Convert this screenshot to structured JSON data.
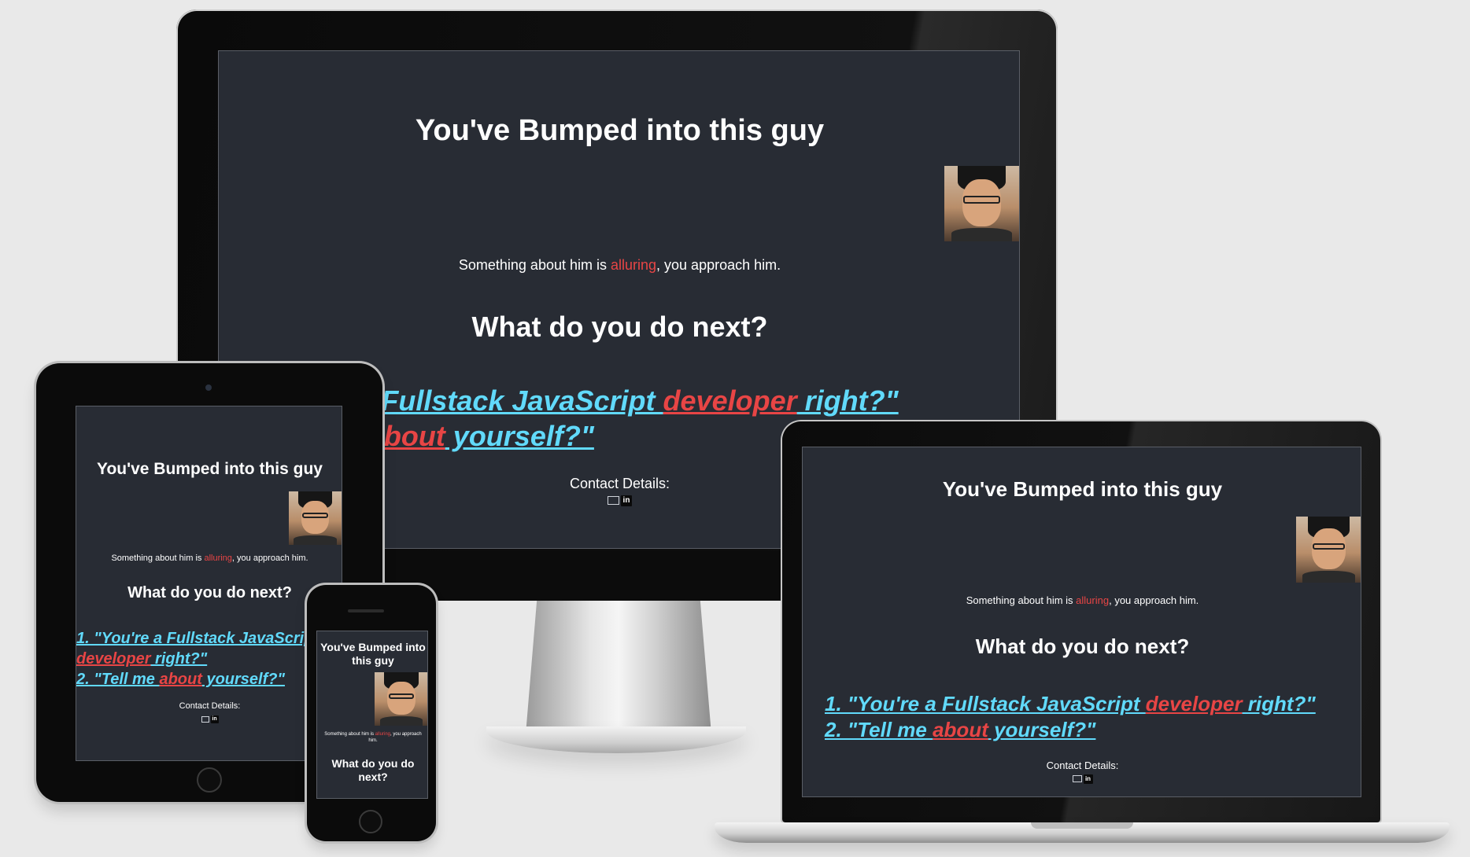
{
  "site": {
    "title": "You've Bumped into this guy",
    "intro_before": "Something about him is ",
    "intro_accent": "alluring",
    "intro_after": ", you approach him.",
    "question": "What do you do next?",
    "option1": {
      "prefix": "1. \"You're a Fullstack JavaScript ",
      "accent": "developer",
      "suffix": " right?\""
    },
    "option2": {
      "prefix": "2. \"Tell me ",
      "accent": "about",
      "suffix": " yourself?\""
    },
    "contact_label": "Contact Details:",
    "linkedin_text": "in"
  },
  "icons": [
    "mail-icon",
    "linkedin-icon",
    "profile-photo"
  ],
  "colors": {
    "page_background": "#e9e9e9",
    "site_background": "#282c34",
    "link": "#61dafb",
    "accent": "#e84545",
    "text": "#ffffff"
  }
}
